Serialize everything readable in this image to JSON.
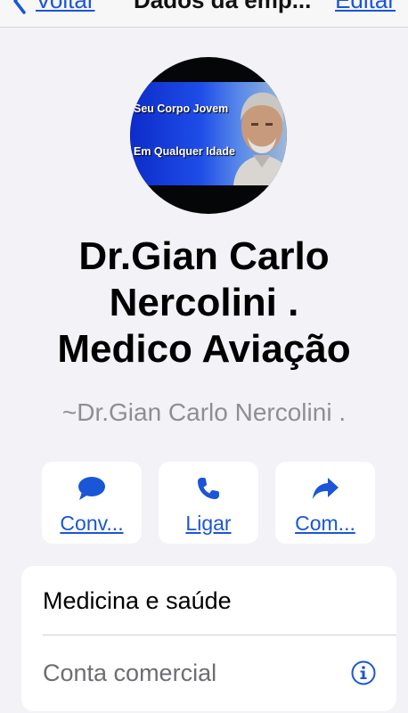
{
  "nav": {
    "back_label": "Voltar",
    "title": "Dados da emp...",
    "edit_label": "Editar"
  },
  "avatar": {
    "line1": "Seu Corpo Jovem",
    "line2": "Em Qualquer Idade"
  },
  "contact": {
    "name_lines": [
      "Dr.Gian Carlo",
      "Nercolini .",
      "Medico Aviação"
    ],
    "subtitle": "~Dr.Gian Carlo Nercolini ."
  },
  "actions": [
    {
      "label": "Conv...",
      "icon": "chat-bubble-icon"
    },
    {
      "label": "Ligar",
      "icon": "phone-icon"
    },
    {
      "label": "Com...",
      "icon": "share-arrow-icon"
    }
  ],
  "info": {
    "category": "Medicina e saúde",
    "account_type": "Conta comercial",
    "info_icon": "info-circle-icon"
  },
  "colors": {
    "accent": "#1a56d6",
    "background": "#f2f2f7",
    "card": "#ffffff",
    "secondary_text": "#8e8e93"
  }
}
